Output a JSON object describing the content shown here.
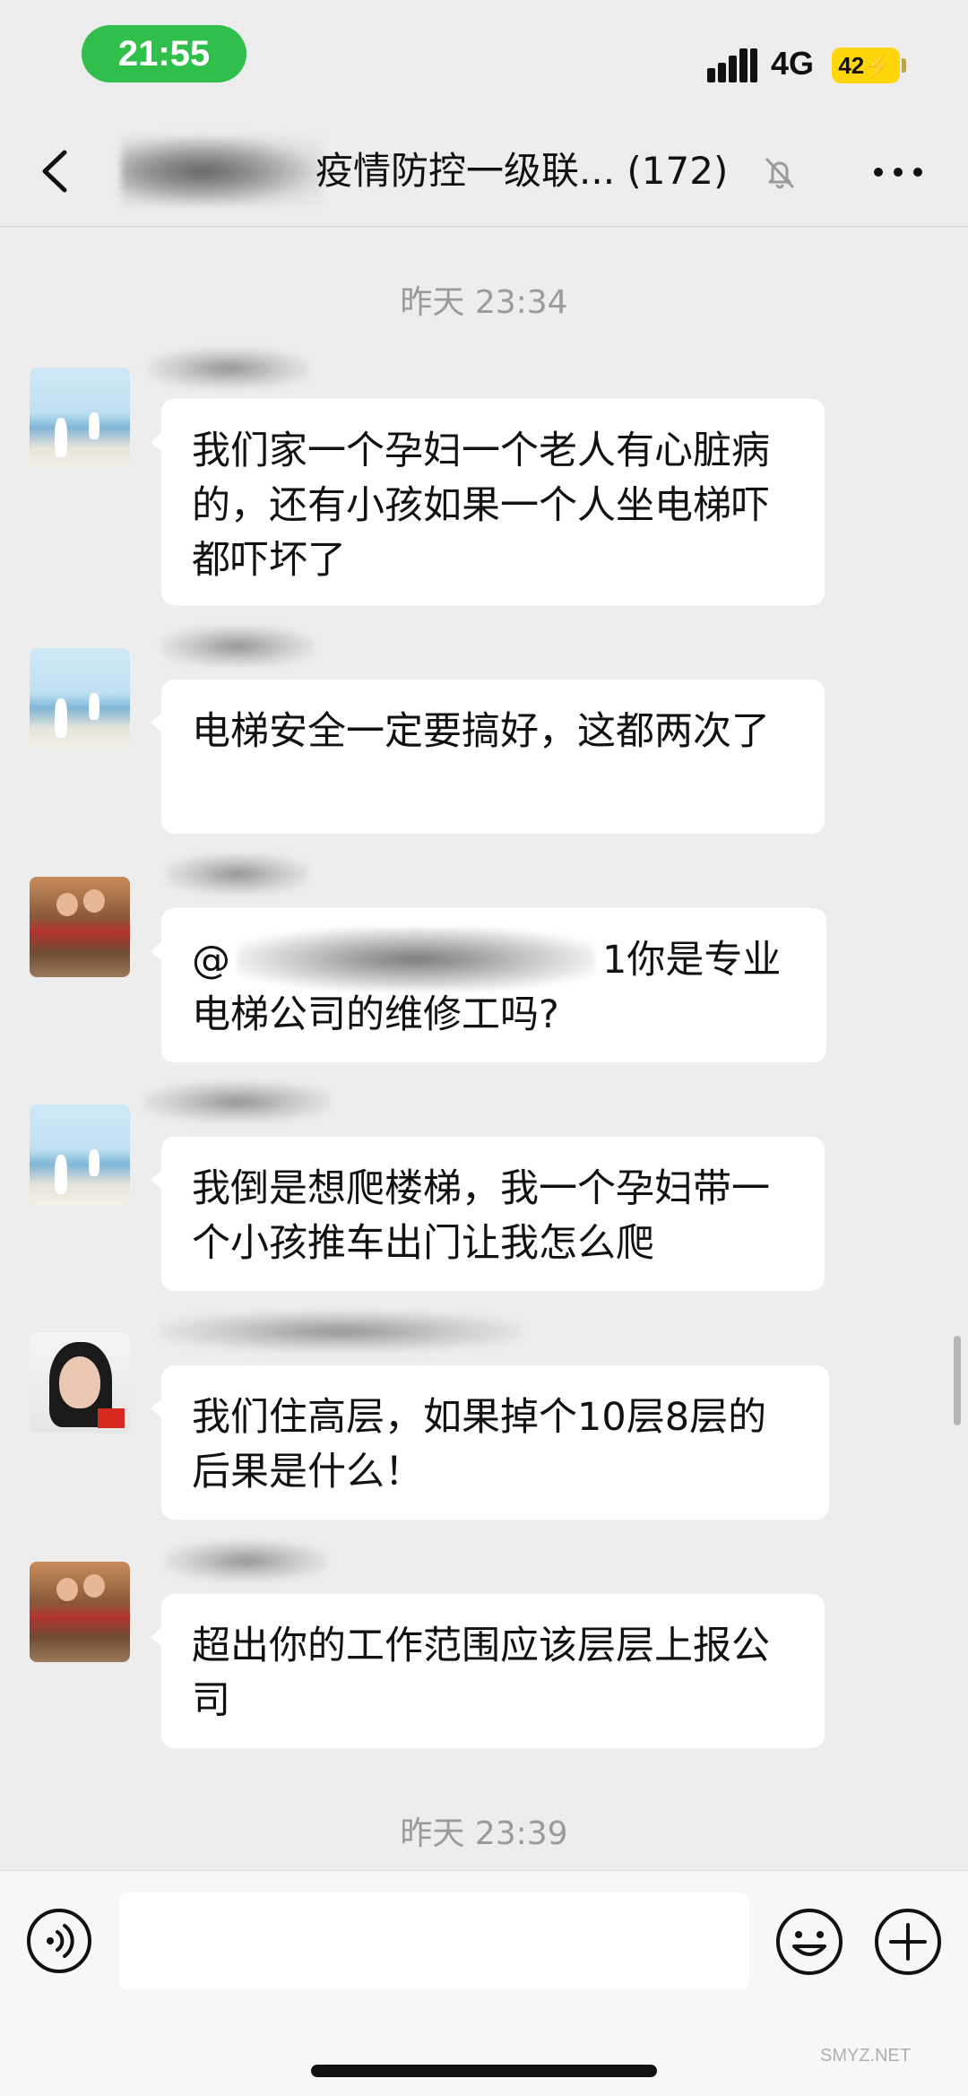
{
  "status_bar": {
    "time": "21:55",
    "network": "4G",
    "battery": "42⚡"
  },
  "header": {
    "title": "疫情防控一级联... (172)"
  },
  "timestamps": [
    "昨天 23:34",
    "昨天 23:39"
  ],
  "messages": [
    {
      "text": "我们家一个孕妇一个老人有心脏病的，还有小孩如果一个人坐电梯吓都吓坏了"
    },
    {
      "text": "电梯安全一定要搞好，这都两次了"
    },
    {
      "mention_prefix": "@",
      "text": "1你是专业电梯公司的维修工吗?"
    },
    {
      "text": "我倒是想爬楼梯，我一个孕妇带一个小孩推车出门让我怎么爬"
    },
    {
      "text": "我们住高层，如果掉个10层8层的后果是什么！"
    },
    {
      "text": "超出你的工作范围应该层层上报公司"
    }
  ],
  "input": {
    "placeholder": ""
  },
  "watermark": "SMYZ.NET",
  "colors": {
    "time_pill": "#2fbf4a",
    "battery": "#ffd60a",
    "background": "#ededed",
    "bubble": "#ffffff"
  }
}
